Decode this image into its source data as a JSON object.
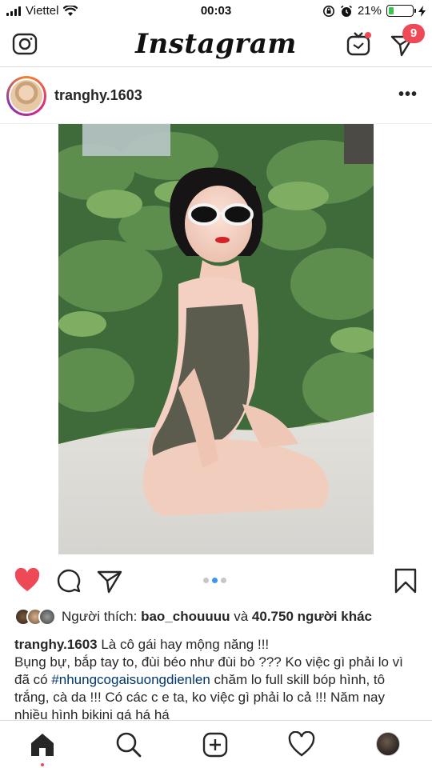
{
  "status_bar": {
    "carrier": "Viettel",
    "time": "00:03",
    "battery": "21%",
    "battery_level": 0.21
  },
  "header": {
    "app_title": "Instagram",
    "direct_badge": "9"
  },
  "post": {
    "username": "tranghy.1603",
    "carousel": {
      "count": 3,
      "active_index": 1
    },
    "likes": {
      "prefix": "Người thích: ",
      "liked_by": "bao_chouuuu",
      "conjunction": " và ",
      "others": "40.750 người khác"
    },
    "caption": {
      "username": "tranghy.1603",
      "text_1": " Là cô gái hay mộng năng !!!",
      "text_2": "Bụng bự, bắp tay to, đùi béo như đùi bò ??? Ko việc gì phải lo vì đã có ",
      "hashtag": "#nhungcogaisuongdienlen",
      "text_3": " chăm lo full skill bóp hình, tô trắng, cà da !!! Có các c e ta, ko việc gì phải lo cả !!! Năm nay nhiều hình bikini qá há há"
    }
  },
  "colors": {
    "like_red": "#ed4956",
    "link_blue": "#003569",
    "dot_active": "#3897f0"
  },
  "icons": [
    "camera-icon",
    "igtv-icon",
    "direct-icon",
    "more-icon",
    "heart-filled-icon",
    "comment-icon",
    "share-icon",
    "bookmark-icon",
    "home-icon",
    "search-icon",
    "new-post-icon",
    "activity-icon"
  ]
}
